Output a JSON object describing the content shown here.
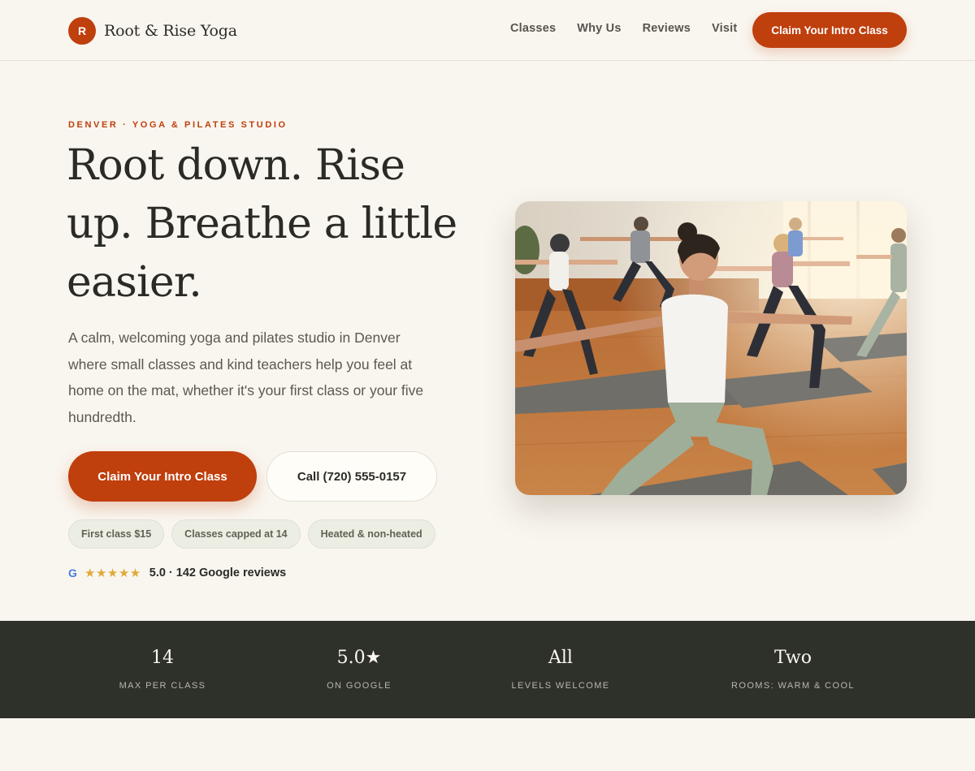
{
  "header": {
    "logo_letter": "R",
    "brand_name": "Root & Rise Yoga",
    "nav": [
      "Classes",
      "Why Us",
      "Reviews",
      "Visit"
    ],
    "cta_label": "Claim Your Intro Class"
  },
  "hero": {
    "eyebrow": "DENVER · YOGA & PILATES STUDIO",
    "headline": "Root down. Rise up. Breathe a little easier.",
    "lede": "A calm, welcoming yoga and pilates studio in Denver where small classes and kind teachers help you feel at home on the mat, whether it's your first class or your five hundredth.",
    "primary_cta": "Claim Your Intro Class",
    "secondary_cta": "Call (720) 555-0157",
    "chips": [
      "First class $15",
      "Classes capped at 14",
      "Heated & non-heated"
    ],
    "rating": {
      "icon": "G",
      "stars": "★★★★★",
      "text": "5.0 · 142 Google reviews"
    }
  },
  "stats": [
    {
      "value": "14",
      "label": "MAX PER CLASS"
    },
    {
      "value": "5.0★",
      "label": "ON GOOGLE"
    },
    {
      "value": "All",
      "label": "LEVELS WELCOME"
    },
    {
      "value": "Two",
      "label": "ROOMS: WARM & COOL"
    }
  ],
  "colors": {
    "accent": "#bf3f0d",
    "background": "#f9f6ef",
    "stats_band": "#2e302a",
    "star": "#e0a93a"
  }
}
